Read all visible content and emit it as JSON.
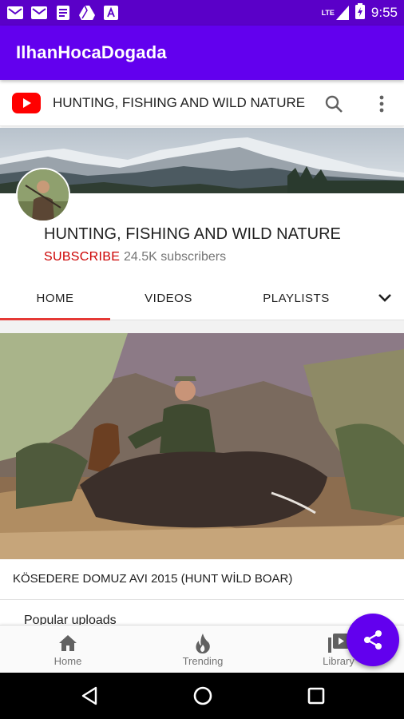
{
  "status_bar": {
    "time": "9:55",
    "network": "LTE",
    "icons": [
      "gmail-icon",
      "gmail-icon",
      "document-icon",
      "drive-icon",
      "font-icon",
      "signal-icon",
      "battery-icon"
    ]
  },
  "app_bar": {
    "title": "IlhanHocaDogada"
  },
  "youtube_header": {
    "channel_title": "HUNTING, FISHING AND WILD NATURE",
    "icons": [
      "youtube-logo-icon",
      "search-icon",
      "more-vert-icon"
    ]
  },
  "channel": {
    "name": "HUNTING, FISHING AND WILD NATURE",
    "subscribe_label": "SUBSCRIBE",
    "subscriber_count": "24.5K subscribers"
  },
  "tabs": {
    "items": [
      {
        "label": "HOME",
        "selected": true
      },
      {
        "label": "VIDEOS",
        "selected": false
      },
      {
        "label": "PLAYLISTS",
        "selected": false
      }
    ],
    "expand_icon": "chevron-down-icon"
  },
  "featured_video": {
    "title": "KÖSEDERE DOMUZ AVI 2015 (HUNT WİLD BOAR)"
  },
  "section": {
    "title": "Popular uploads"
  },
  "bottom_nav": {
    "items": [
      {
        "label": "Home",
        "icon": "home-icon"
      },
      {
        "label": "Trending",
        "icon": "flame-icon"
      },
      {
        "label": "Library",
        "icon": "library-icon"
      }
    ]
  },
  "fab": {
    "icon": "share-icon"
  },
  "colors": {
    "primary": "#6200ee",
    "status_bar": "#5a00c8",
    "youtube_red": "#ff0000",
    "subscribe_red": "#cc0000",
    "tab_indicator": "#e53935"
  }
}
